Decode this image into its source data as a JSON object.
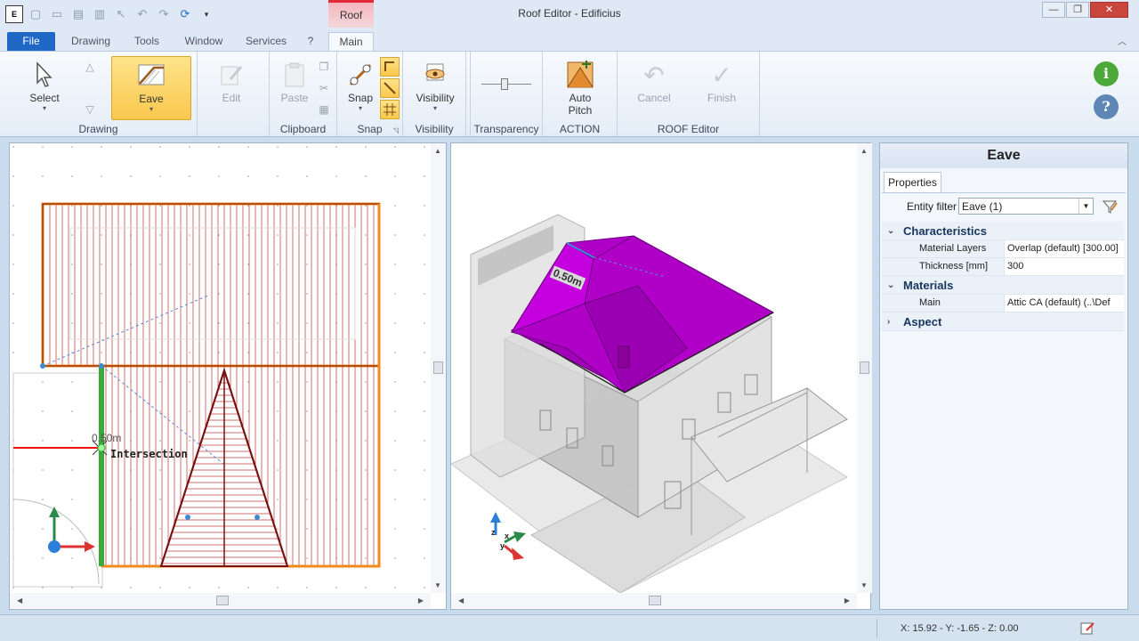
{
  "window": {
    "title": "Roof Editor - Edificius",
    "contextual_tab": "Roof",
    "controls": [
      "—",
      "❐",
      "✕"
    ]
  },
  "qat_icons": [
    "new-icon",
    "open-icon",
    "save-icon",
    "print-icon",
    "pointer-icon",
    "undo-icon",
    "redo-icon",
    "refresh-icon",
    "customize-icon"
  ],
  "tabs": {
    "file": "File",
    "drawing": "Drawing",
    "tools": "Tools",
    "window": "Window",
    "services": "Services",
    "help": "?",
    "main": "Main"
  },
  "ribbon": {
    "select": "Select",
    "eave": "Eave",
    "edit": "Edit",
    "drawing_group": "Drawing",
    "paste": "Paste",
    "clipboard_group": "Clipboard",
    "snap": "Snap",
    "snap_group": "Snap",
    "visibility": "Visibility",
    "visibility_group": "Visibility",
    "transparency_group": "Transparency",
    "auto_pitch_1": "Auto",
    "auto_pitch_2": "Pitch",
    "action_group": "ACTION",
    "cancel": "Cancel",
    "finish": "Finish",
    "roof_editor_group": "ROOF Editor",
    "info": "i",
    "help": "?"
  },
  "viewport_2d": {
    "dimension_label": "0.50m",
    "snap_tooltip": "Intersection"
  },
  "viewport_3d": {
    "dimension_label": "0.50m",
    "axes": [
      "z",
      "x",
      "y"
    ]
  },
  "properties": {
    "title": "Eave",
    "tab": "Properties",
    "filter_label": "Entity filter",
    "filter_value": "Eave (1)",
    "categories": [
      {
        "name": "Characteristics",
        "expanded": true,
        "rows": [
          {
            "name": "Material Layers",
            "value": "Overlap (default) [300.00]"
          },
          {
            "name": "Thickness  [mm]",
            "value": "300"
          }
        ]
      },
      {
        "name": "Materials",
        "expanded": true,
        "rows": [
          {
            "name": "Main",
            "value": "Attic CA (default)   (..\\Def"
          }
        ]
      },
      {
        "name": "Aspect",
        "expanded": false,
        "rows": []
      }
    ]
  },
  "status": {
    "coords": "X: 15.92 - Y: -1.65 - Z: 0.00"
  },
  "colors": {
    "accent": "#1f68c6",
    "roof": "#b000c8",
    "eave_outline": "#f08a1c",
    "contextual": "#e02a3a"
  }
}
